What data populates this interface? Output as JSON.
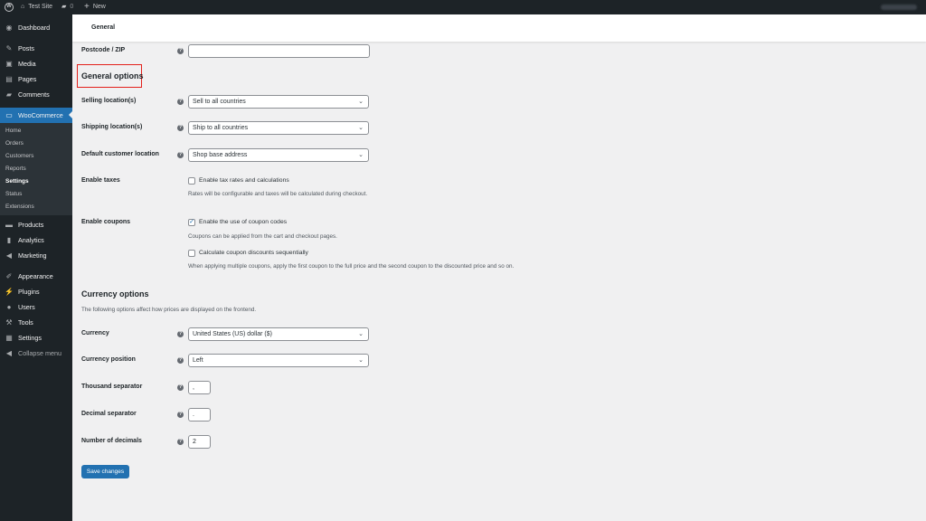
{
  "adminbar": {
    "site": "Test Site",
    "comments": "0",
    "new": "New"
  },
  "sidebar": {
    "items": [
      {
        "label": "Dashboard",
        "icon": "dashboard-icon"
      },
      {
        "label": "Posts",
        "icon": "pin-icon"
      },
      {
        "label": "Media",
        "icon": "media-icon"
      },
      {
        "label": "Pages",
        "icon": "pages-icon"
      },
      {
        "label": "Comments",
        "icon": "comment-icon"
      },
      {
        "label": "WooCommerce",
        "icon": "woo-icon"
      },
      {
        "label": "Products",
        "icon": "products-icon"
      },
      {
        "label": "Analytics",
        "icon": "analytics-icon"
      },
      {
        "label": "Marketing",
        "icon": "megaphone-icon"
      },
      {
        "label": "Appearance",
        "icon": "brush-icon"
      },
      {
        "label": "Plugins",
        "icon": "plugin-icon"
      },
      {
        "label": "Users",
        "icon": "user-icon"
      },
      {
        "label": "Tools",
        "icon": "wrench-icon"
      },
      {
        "label": "Settings",
        "icon": "settings-icon"
      },
      {
        "label": "Collapse menu",
        "icon": "collapse-icon"
      }
    ],
    "woo_sub": [
      "Home",
      "Orders",
      "Customers",
      "Reports",
      "Settings",
      "Status",
      "Extensions"
    ]
  },
  "header": {
    "title": "General"
  },
  "form": {
    "postcode_label": "Postcode / ZIP",
    "postcode_value": "",
    "general_heading": "General options",
    "selling_label": "Selling location(s)",
    "selling_value": "Sell to all countries",
    "shipping_label": "Shipping location(s)",
    "shipping_value": "Ship to all countries",
    "default_loc_label": "Default customer location",
    "default_loc_value": "Shop base address",
    "taxes_label": "Enable taxes",
    "taxes_check": "Enable tax rates and calculations",
    "taxes_desc": "Rates will be configurable and taxes will be calculated during checkout.",
    "coupons_label": "Enable coupons",
    "coupons_check": "Enable the use of coupon codes",
    "coupons_desc": "Coupons can be applied from the cart and checkout pages.",
    "seq_check": "Calculate coupon discounts sequentially",
    "seq_desc": "When applying multiple coupons, apply the first coupon to the full price and the second coupon to the discounted price and so on.",
    "currency_heading": "Currency options",
    "currency_desc": "The following options affect how prices are displayed on the frontend.",
    "currency_label": "Currency",
    "currency_value": "United States (US) dollar ($)",
    "position_label": "Currency position",
    "position_value": "Left",
    "thousand_label": "Thousand separator",
    "thousand_value": ",",
    "decimal_label": "Decimal separator",
    "decimal_value": ".",
    "decimals_label": "Number of decimals",
    "decimals_value": "2",
    "save": "Save changes"
  },
  "colors": {
    "accent": "#2271b1",
    "highlight_box": "#e3201b"
  }
}
